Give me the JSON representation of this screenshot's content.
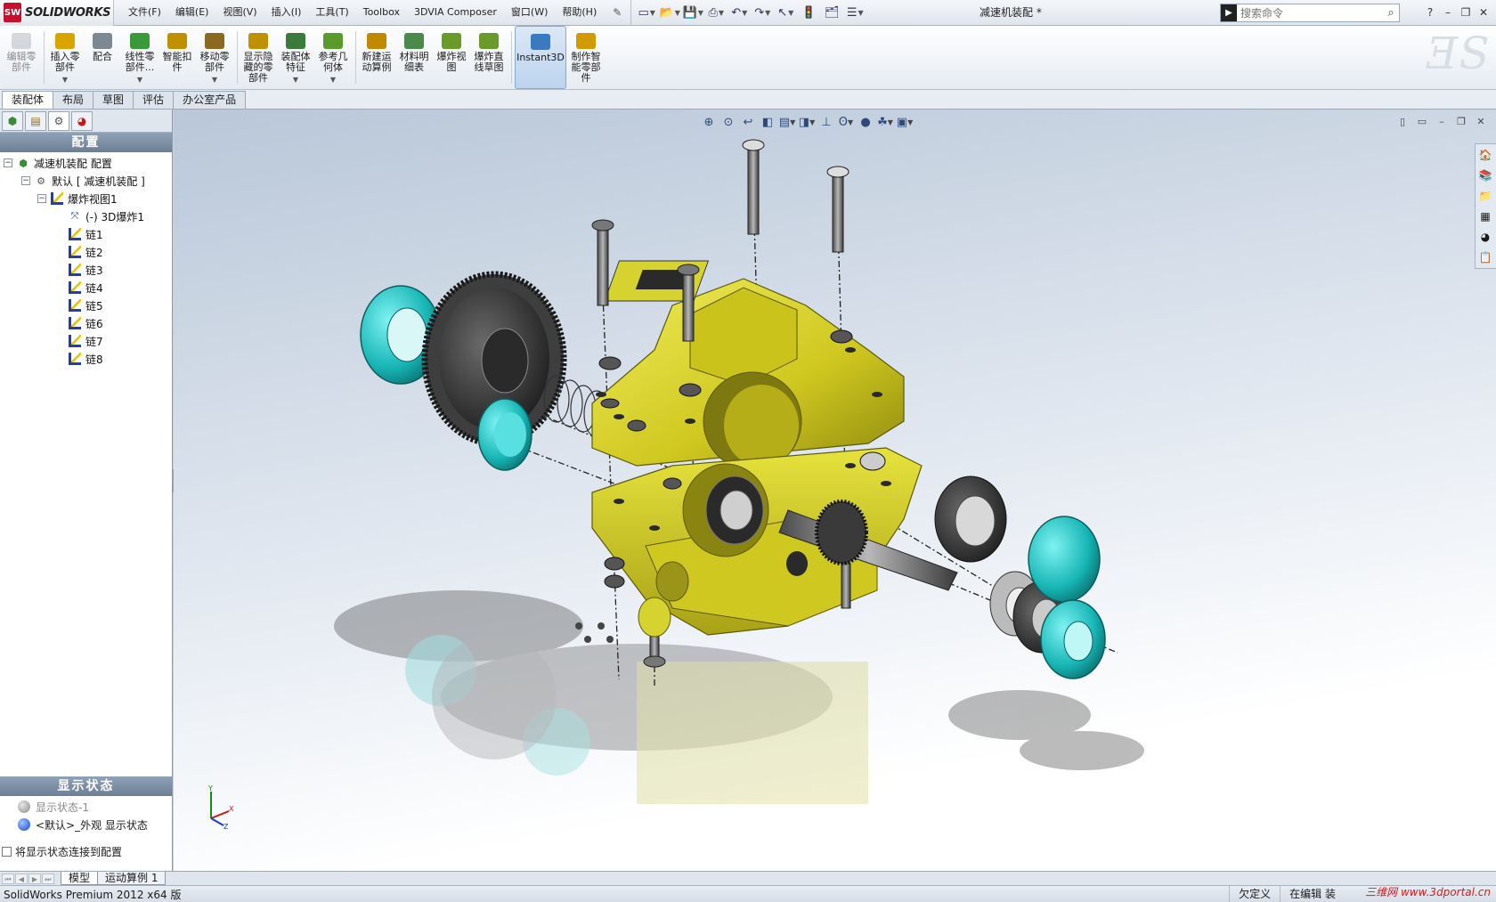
{
  "app": {
    "logo_mark": "SW",
    "logo_text": "SOLIDWORKS",
    "doc_title": "减速机装配 *"
  },
  "menu": [
    "文件(F)",
    "编辑(E)",
    "视图(V)",
    "插入(I)",
    "工具(T)",
    "Toolbox",
    "3DVIA Composer",
    "窗口(W)",
    "帮助(H)"
  ],
  "search": {
    "placeholder": "搜索命令"
  },
  "ribbon": [
    {
      "label": "编辑零部件",
      "icon": "edit-component-icon",
      "color": "#b0b6bc",
      "disabled": true
    },
    {
      "label": "插入零部件",
      "icon": "insert-component-icon",
      "color": "#d9a400",
      "drop": true
    },
    {
      "label": "配合",
      "icon": "mate-icon",
      "color": "#7c8892"
    },
    {
      "label": "线性零部件...",
      "icon": "linear-pattern-icon",
      "color": "#3a9a3a",
      "drop": true
    },
    {
      "label": "智能扣件",
      "icon": "smart-fastener-icon",
      "color": "#c09000"
    },
    {
      "label": "移动零部件",
      "icon": "move-component-icon",
      "color": "#8a6a20",
      "drop": true
    },
    {
      "label": "显示隐藏的零部件",
      "icon": "show-hidden-icon",
      "color": "#c09000"
    },
    {
      "label": "装配体特征",
      "icon": "assembly-feature-icon",
      "color": "#3a7a3a",
      "drop": true
    },
    {
      "label": "参考几何体",
      "icon": "reference-geometry-icon",
      "color": "#5a9a2a",
      "drop": true
    },
    {
      "label": "新建运动算例",
      "icon": "motion-study-icon",
      "color": "#c08a00"
    },
    {
      "label": "材料明细表",
      "icon": "bom-icon",
      "color": "#4a8a4a"
    },
    {
      "label": "爆炸视图",
      "icon": "exploded-view-icon",
      "color": "#6a9a2a"
    },
    {
      "label": "爆炸直线草图",
      "icon": "explode-line-icon",
      "color": "#6a9a2a"
    },
    {
      "label": "Instant3D",
      "icon": "instant3d-icon",
      "color": "#3a7ac0",
      "active": true
    },
    {
      "label": "制作智能零部件",
      "icon": "smart-component-icon",
      "color": "#d09a00"
    }
  ],
  "cm_tabs": [
    "装配体",
    "布局",
    "草图",
    "评估",
    "办公室产品"
  ],
  "pm_tabs": [
    "feature-manager-icon",
    "property-manager-icon",
    "configuration-manager-icon",
    "display-manager-icon"
  ],
  "config_header": "配置",
  "tree": {
    "root": "减速机装配 配置",
    "config": "默认 [ 减速机装配 ]",
    "explode_view": "爆炸视图1",
    "explode3d": "(-) 3D爆炸1",
    "chains": [
      "链1",
      "链2",
      "链3",
      "链4",
      "链5",
      "链6",
      "链7",
      "链8"
    ]
  },
  "display_state": {
    "header": "显示状态",
    "items": [
      "显示状态-1",
      "<默认>_外观 显示状态"
    ],
    "link_label": "将显示状态连接到配置"
  },
  "bottom_tabs": [
    "模型",
    "运动算例 1"
  ],
  "status": {
    "version": "SolidWorks Premium 2012 x64 版",
    "cell1": "欠定义",
    "cell2": "在编辑 装"
  },
  "watermark": "三维网 www.3dportal.cn",
  "colors": {
    "housing": "#d6d22a",
    "cover": "#22c8c8",
    "gear": "#3a3a3a",
    "accent": "#c8102e"
  }
}
